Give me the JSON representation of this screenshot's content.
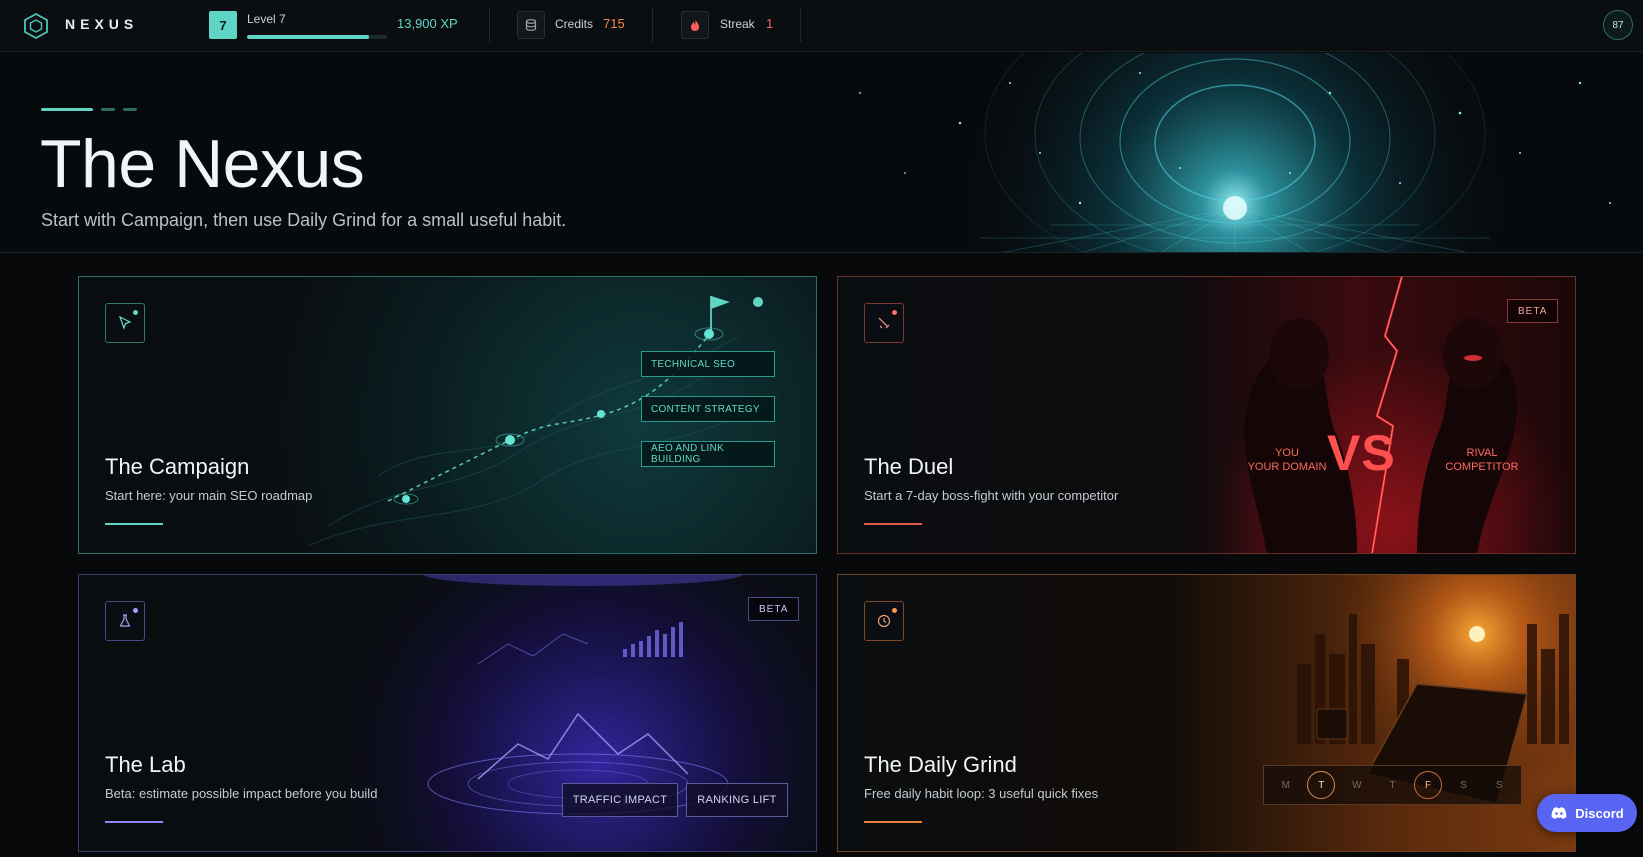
{
  "header": {
    "brand": "NEXUS",
    "level_number": "7",
    "level_label": "Level 7",
    "xp_progress": 0.87,
    "xp": "13,900 XP",
    "credits_label": "Credits",
    "credits_value": "715",
    "streak_label": "Streak",
    "streak_value": "1",
    "avatar": "87"
  },
  "hero": {
    "title": "The Nexus",
    "subtitle": "Start with Campaign, then use Daily Grind for a small useful habit."
  },
  "cards": {
    "campaign": {
      "icon": "cursor-icon",
      "title": "The Campaign",
      "desc": "Start here: your main SEO roadmap",
      "tags": [
        "TECHNICAL SEO",
        "CONTENT STRATEGY",
        "AEO AND LINK BUILDING"
      ]
    },
    "duel": {
      "icon": "sword-icon",
      "badge": "BETA",
      "title": "The Duel",
      "desc": "Start a 7-day boss-fight with your competitor",
      "you_1": "YOU",
      "you_2": "YOUR DOMAIN",
      "vs": "VS",
      "rival_1": "RIVAL",
      "rival_2": "COMPETITOR"
    },
    "lab": {
      "icon": "flask-icon",
      "badge": "BETA",
      "title": "The Lab",
      "desc": "Beta: estimate possible impact before you build",
      "tags": [
        "TRAFFIC IMPACT",
        "RANKING LIFT"
      ]
    },
    "grind": {
      "icon": "clock-icon",
      "title": "The Daily Grind",
      "desc": "Free daily habit loop: 3 useful quick fixes",
      "days": [
        "M",
        "T",
        "W",
        "T",
        "F",
        "S",
        "S"
      ]
    }
  },
  "discord": {
    "label": "Discord"
  },
  "colors": {
    "teal": "#5fd6c5",
    "red": "#ff5050",
    "purple": "#8f86ff",
    "orange": "#e8823e",
    "discord": "#5865f2"
  }
}
